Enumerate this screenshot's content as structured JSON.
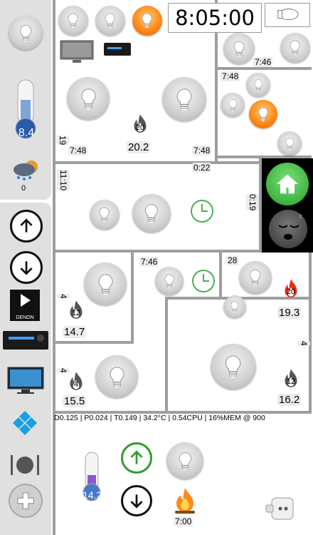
{
  "clock": {
    "time": "8:05:00"
  },
  "sidebar": {
    "thermometer_value": "8.4",
    "weather_value": "0",
    "denon_label": "DENON"
  },
  "rooms": {
    "top_right_time": "7:46",
    "right_small_time": "7:48",
    "living_left_time": "7:48",
    "living_bottom_time": "7:48",
    "living_vertical_num": "19",
    "living_flame_num": "20",
    "living_temp": "20.2",
    "hall_time": "0:22",
    "hall_vertical_time_left": "11:10",
    "hall_vertical_time_right": "0:19",
    "mid_time": "7:46",
    "right_room_badge": "28",
    "right_room_flame_num": "20",
    "right_room_temp": "19.3",
    "left_room_vertical": "4",
    "left_room_flame_num": "12",
    "left_room_temp": "14.7",
    "bottom_left_vertical": "4",
    "bottom_left_flame_num": "4",
    "bottom_left_temp": "15.5",
    "bottom_right_vertical": "4",
    "bottom_right_flame_num": "12",
    "bottom_right_temp": "16.2"
  },
  "status": {
    "text": "D0.125 | P0.024 | T0.149 | 34.2°C | 0.54CPU | 16%MEM @ 900"
  },
  "bottom": {
    "thermometer_value": "14.2",
    "fire_time": "7:00"
  },
  "colors": {
    "accent_green": "#2e9e2e",
    "bulb_on": "#ff8a1a",
    "wall": "#9e9e9e"
  }
}
